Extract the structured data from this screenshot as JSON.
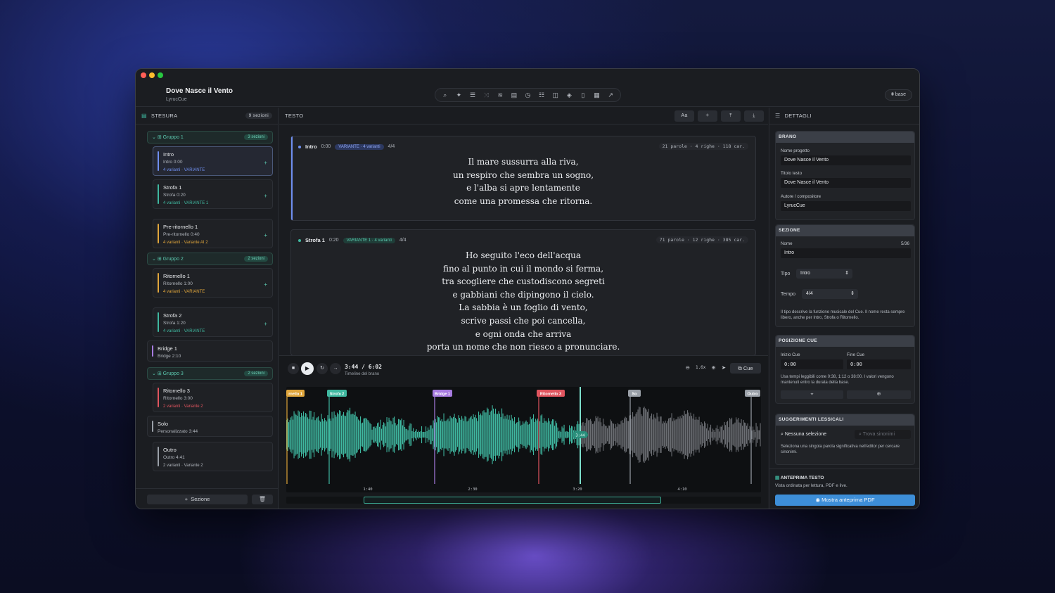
{
  "app": {
    "title": "Dove Nasce il Vento",
    "subtitle": "LyrucCue",
    "mode_label": "base"
  },
  "toolbar_icons": [
    "search-icon",
    "wand-icon",
    "list-icon",
    "shuffle-icon",
    "waveform-icon",
    "document-icon",
    "clock-icon",
    "checklist-icon",
    "columns-icon",
    "layers-icon",
    "bookmark-icon",
    "notes-icon",
    "share-icon"
  ],
  "left": {
    "header": "STESURA",
    "count": "9 sezioni",
    "add_label": "Sezione",
    "groups": [
      {
        "name": "Gruppo 1",
        "count": "3 sezioni"
      },
      {
        "name": "Gruppo 2",
        "count": "2 sezioni"
      },
      {
        "name": "Gruppo 3",
        "count": "2 sezioni"
      }
    ],
    "cards": [
      {
        "title": "Intro",
        "meta": "Intro  0:00",
        "variants": "4 varianti · VARIANTE",
        "color": "#6f8ff0"
      },
      {
        "title": "Strofa 1",
        "meta": "Strofa  0:20",
        "variants": "4 varianti · VARIANTE 1",
        "color": "#3fb8a0"
      },
      {
        "title": "Pre-ritornello 1",
        "meta": "Pre-ritornello  0:40",
        "variants": "4 varianti · Variante AI 2",
        "color": "#e0a63c"
      },
      {
        "title": "Ritornello 1",
        "meta": "Ritornello  1:00",
        "variants": "4 varianti · VARIANTE",
        "color": "#e0a63c"
      },
      {
        "title": "Strofa 2",
        "meta": "Strofa  1:20",
        "variants": "4 varianti · VARIANTE",
        "color": "#3fb8a0"
      },
      {
        "title": "Bridge 1",
        "meta": "Bridge  2:10",
        "variants": "",
        "color": "#a77be0"
      },
      {
        "title": "Ritornello 3",
        "meta": "Ritornello  3:00",
        "variants": "2 varianti · Variante 2",
        "color": "#e0555f"
      },
      {
        "title": "Solo",
        "meta": "Personalizzato  3:44",
        "variants": "",
        "color": "#9aa0a8"
      },
      {
        "title": "Outro",
        "meta": "Outro  4:41",
        "variants": "2 varianti · Variante 2",
        "color": "#9aa0a8"
      }
    ]
  },
  "center": {
    "header": "TESTO",
    "tools": [
      "Aa",
      "✧",
      "⤒",
      "⤓"
    ],
    "sections": [
      {
        "name": "Intro",
        "time": "0:00",
        "badge": "VARIANTE · 4 varianti",
        "meter": "4/4",
        "stats": "21 parole · 4 righe · 118 car.",
        "lines": [
          "Il mare sussurra alla riva,",
          "un respiro che sembra un sogno,",
          "e l'alba si apre lentamente",
          "come una promessa che ritorna."
        ]
      },
      {
        "name": "Strofa 1",
        "time": "0:20",
        "badge": "VARIANTE 1 · 4 varianti",
        "meter": "4/4",
        "stats": "71 parole · 12 righe · 385 car.",
        "lines": [
          "Ho seguito l'eco dell'acqua",
          "fino al punto in cui il mondo si ferma,",
          "tra scogliere che custodiscono segreti",
          "e gabbiani che dipingono il cielo.",
          "La sabbia è un foglio di vento,",
          "scrive passi che poi cancella,",
          "e ogni onda che arriva",
          "porta un nome che non riesco a pronunciare."
        ]
      }
    ]
  },
  "player": {
    "time": "3:44 / 6:02",
    "subtitle": "Timeline del brano",
    "zoom": "1.6x",
    "cue_label": "Cue",
    "playhead": "3:44",
    "markers": [
      {
        "label": "rnello 1",
        "color": "#e0a63c"
      },
      {
        "label": "Strofa 2",
        "color": "#3fb8a0"
      },
      {
        "label": "Bridge 1",
        "color": "#a77be0"
      },
      {
        "label": "Ritornello 3",
        "color": "#e0555f"
      },
      {
        "label": "So",
        "color": "#9aa0a8"
      },
      {
        "label": "Outro",
        "color": "#9aa0a8"
      }
    ],
    "ticks": [
      "1:40",
      "2:30",
      "3:20",
      "4:10"
    ],
    "played_color": "#3fb8a0",
    "unplayed_color": "#6b6e73",
    "progress": 0.6188
  },
  "right": {
    "header": "DETTAGLI",
    "brano": {
      "title": "BRANO",
      "nome_label": "Nome progetto",
      "nome": "Dove Nasce il Vento",
      "titolo_label": "Titolo testo",
      "titolo": "Dove Nasce il Vento",
      "autore_label": "Autore / compositore",
      "autore": "LyrucCue"
    },
    "sezione": {
      "title": "SEZIONE",
      "nome_label": "Nome",
      "nome_count": "5/36",
      "nome": "Intro",
      "tipo_label": "Tipo",
      "tipo": "Intro",
      "tempo_label": "Tempo",
      "tempo": "4/4",
      "note": "Il tipo descrive la funzione musicale del Cue. Il nome resta sempre libero, anche per Intro, Strofa o Ritornello."
    },
    "posizione": {
      "title": "POSIZIONE CUE",
      "inizio_label": "Inizio Cue",
      "inizio": "0:00",
      "fine_label": "Fine Cue",
      "fine": "0:00",
      "note": "Usa tempi leggibili come 0:38, 1:12 o 38:00. I valori vengono mantenuti entro la durata della base."
    },
    "suggerimenti": {
      "title": "SUGGERIMENTI LESSICALI",
      "selection": "Nessuna selezione",
      "search_placeholder": "Trova sinonimi",
      "note": "Seleziona una singola parola significativa nell'editor per cercare sinonimi."
    },
    "anteprima": {
      "title": "ANTEPRIMA TESTO",
      "desc": "Vista ordinata per lettura, PDF e live.",
      "button": "Mostra anteprima PDF"
    }
  }
}
